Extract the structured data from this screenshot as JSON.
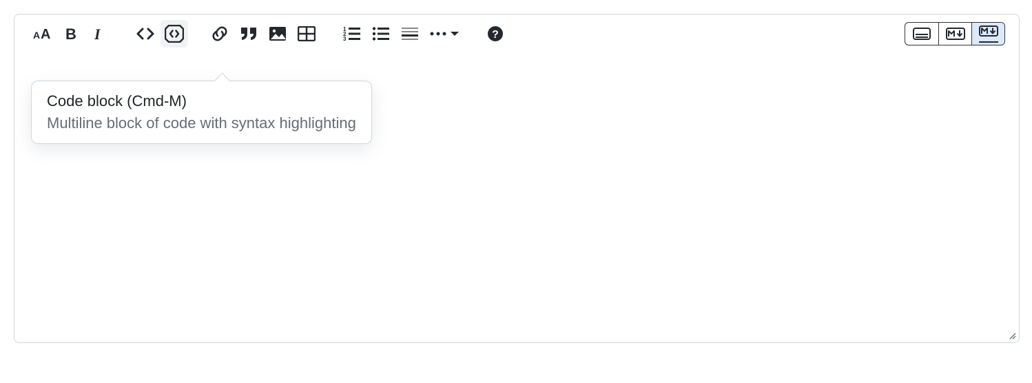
{
  "tooltip": {
    "title": "Code block (Cmd-M)",
    "description": "Multiline block of code with syntax highlighting"
  },
  "toolbar": {
    "text_style": "Text style",
    "bold": "Bold",
    "italic": "Italic",
    "code_inline": "Inline code",
    "code_block": "Code block",
    "link": "Link",
    "quote": "Quote",
    "image": "Image",
    "table": "Table",
    "ordered_list": "Ordered list",
    "unordered_list": "Unordered list",
    "horizontal_rule": "Horizontal rule",
    "more": "More options",
    "help": "Help"
  },
  "view": {
    "wysiwyg": "WYSIWYG",
    "markdown": "Markdown",
    "split": "Split view"
  }
}
